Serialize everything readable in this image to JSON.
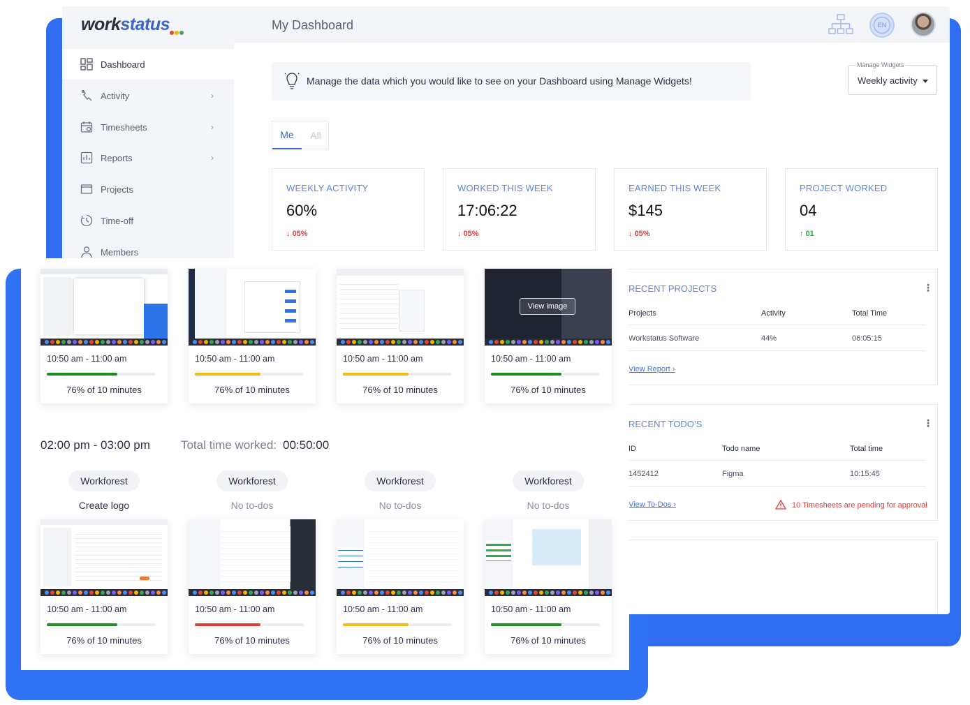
{
  "app": {
    "logo_work": "work",
    "logo_status": "status",
    "logo_dot_colors": [
      "#e94335",
      "#f5b400",
      "#34a853"
    ],
    "page_title": "My Dashboard",
    "org_chart_icon": "org-chart-icon",
    "language": "EN",
    "avatar_icon": "user-avatar"
  },
  "sidebar": {
    "collapse_icon": "double-chevron-left-icon",
    "items": [
      {
        "label": "Dashboard",
        "icon": "grid-icon",
        "active": true,
        "has_submenu": false
      },
      {
        "label": "Activity",
        "icon": "activity-icon",
        "active": false,
        "has_submenu": true
      },
      {
        "label": "Timesheets",
        "icon": "calendar-icon",
        "active": false,
        "has_submenu": true
      },
      {
        "label": "Reports",
        "icon": "report-icon",
        "active": false,
        "has_submenu": true
      },
      {
        "label": "Projects",
        "icon": "folder-icon",
        "active": false,
        "has_submenu": false
      },
      {
        "label": "Time-off",
        "icon": "timer-icon",
        "active": false,
        "has_submenu": false
      },
      {
        "label": "Members",
        "icon": "person-icon",
        "active": false,
        "has_submenu": false
      }
    ]
  },
  "notice": {
    "icon": "lightbulb-icon",
    "text": "Manage the data which you would like to see on your Dashboard using Manage Widgets!"
  },
  "manage_widgets": {
    "label": "Manage Widgets",
    "value": "Weekly activity"
  },
  "tabs": {
    "me": "Me",
    "all": "All",
    "active": "Me"
  },
  "stats": [
    {
      "title": "WEEKLY ACTIVITY",
      "value": "60%",
      "delta": "05%",
      "direction": "down"
    },
    {
      "title": "WORKED THIS WEEK",
      "value": "17:06:22",
      "delta": "05%",
      "direction": "down"
    },
    {
      "title": "EARNED THIS WEEK",
      "value": "$145",
      "delta": "05%",
      "direction": "down"
    },
    {
      "title": "PROJECT WORKED",
      "value": "04",
      "delta": "01",
      "direction": "up"
    }
  ],
  "recent_projects": {
    "title": "RECENT PROJECTS",
    "columns": [
      "Projects",
      "Activity",
      "Total Time"
    ],
    "rows": [
      {
        "project": "Workstatus Software",
        "activity": "44%",
        "total_time": "06:05:15"
      }
    ],
    "link": "View Report"
  },
  "recent_todos": {
    "title": "RECENT TODO’S",
    "columns": [
      "ID",
      "Todo name",
      "Total time"
    ],
    "rows": [
      {
        "id": "1452412",
        "name": "Figma",
        "total_time": "10:15:45"
      }
    ],
    "link": "View To-Dos",
    "warning": "10 Timesheets are pending for approval",
    "warning_icon": "warning-triangle-icon"
  },
  "activity": {
    "top_cards": [
      {
        "time": "10:50 am - 11:00 am",
        "percent_text": "76% of 10 minutes",
        "progress": 0.65,
        "bar_color": "#1f8b24",
        "view_image": ""
      },
      {
        "time": "10:50 am - 11:00 am",
        "percent_text": "76% of 10 minutes",
        "progress": 0.6,
        "bar_color": "#f4b914",
        "view_image": ""
      },
      {
        "time": "10:50 am - 11:00 am",
        "percent_text": "76% of 10 minutes",
        "progress": 0.6,
        "bar_color": "#f4b914",
        "view_image": ""
      },
      {
        "time": "10:50 am - 11:00 am",
        "percent_text": "76% of 10 minutes",
        "progress": 0.65,
        "bar_color": "#1f8b24",
        "view_image": "View image"
      }
    ],
    "range": "02:00 pm - 03:00 pm",
    "total_label": "Total time worked:",
    "total_value": "00:50:00",
    "bottom_cards": [
      {
        "project": "Workforest",
        "todo": "Create logo",
        "has_todo": true,
        "time": "10:50 am - 11:00 am",
        "percent_text": "76% of 10 minutes",
        "progress": 0.65,
        "bar_color": "#1f8b24"
      },
      {
        "project": "Workforest",
        "todo": "No to-dos",
        "has_todo": false,
        "time": "10:50 am - 11:00 am",
        "percent_text": "76% of 10 minutes",
        "progress": 0.6,
        "bar_color": "#e23a3a"
      },
      {
        "project": "Workforest",
        "todo": "No to-dos",
        "has_todo": false,
        "time": "10:50 am - 11:00 am",
        "percent_text": "76% of 10 minutes",
        "progress": 0.6,
        "bar_color": "#f4b914"
      },
      {
        "project": "Workforest",
        "todo": "No to-dos",
        "has_todo": false,
        "time": "10:50 am - 11:00 am",
        "percent_text": "76% of 10 minutes",
        "progress": 0.65,
        "bar_color": "#1f8b24"
      }
    ]
  }
}
